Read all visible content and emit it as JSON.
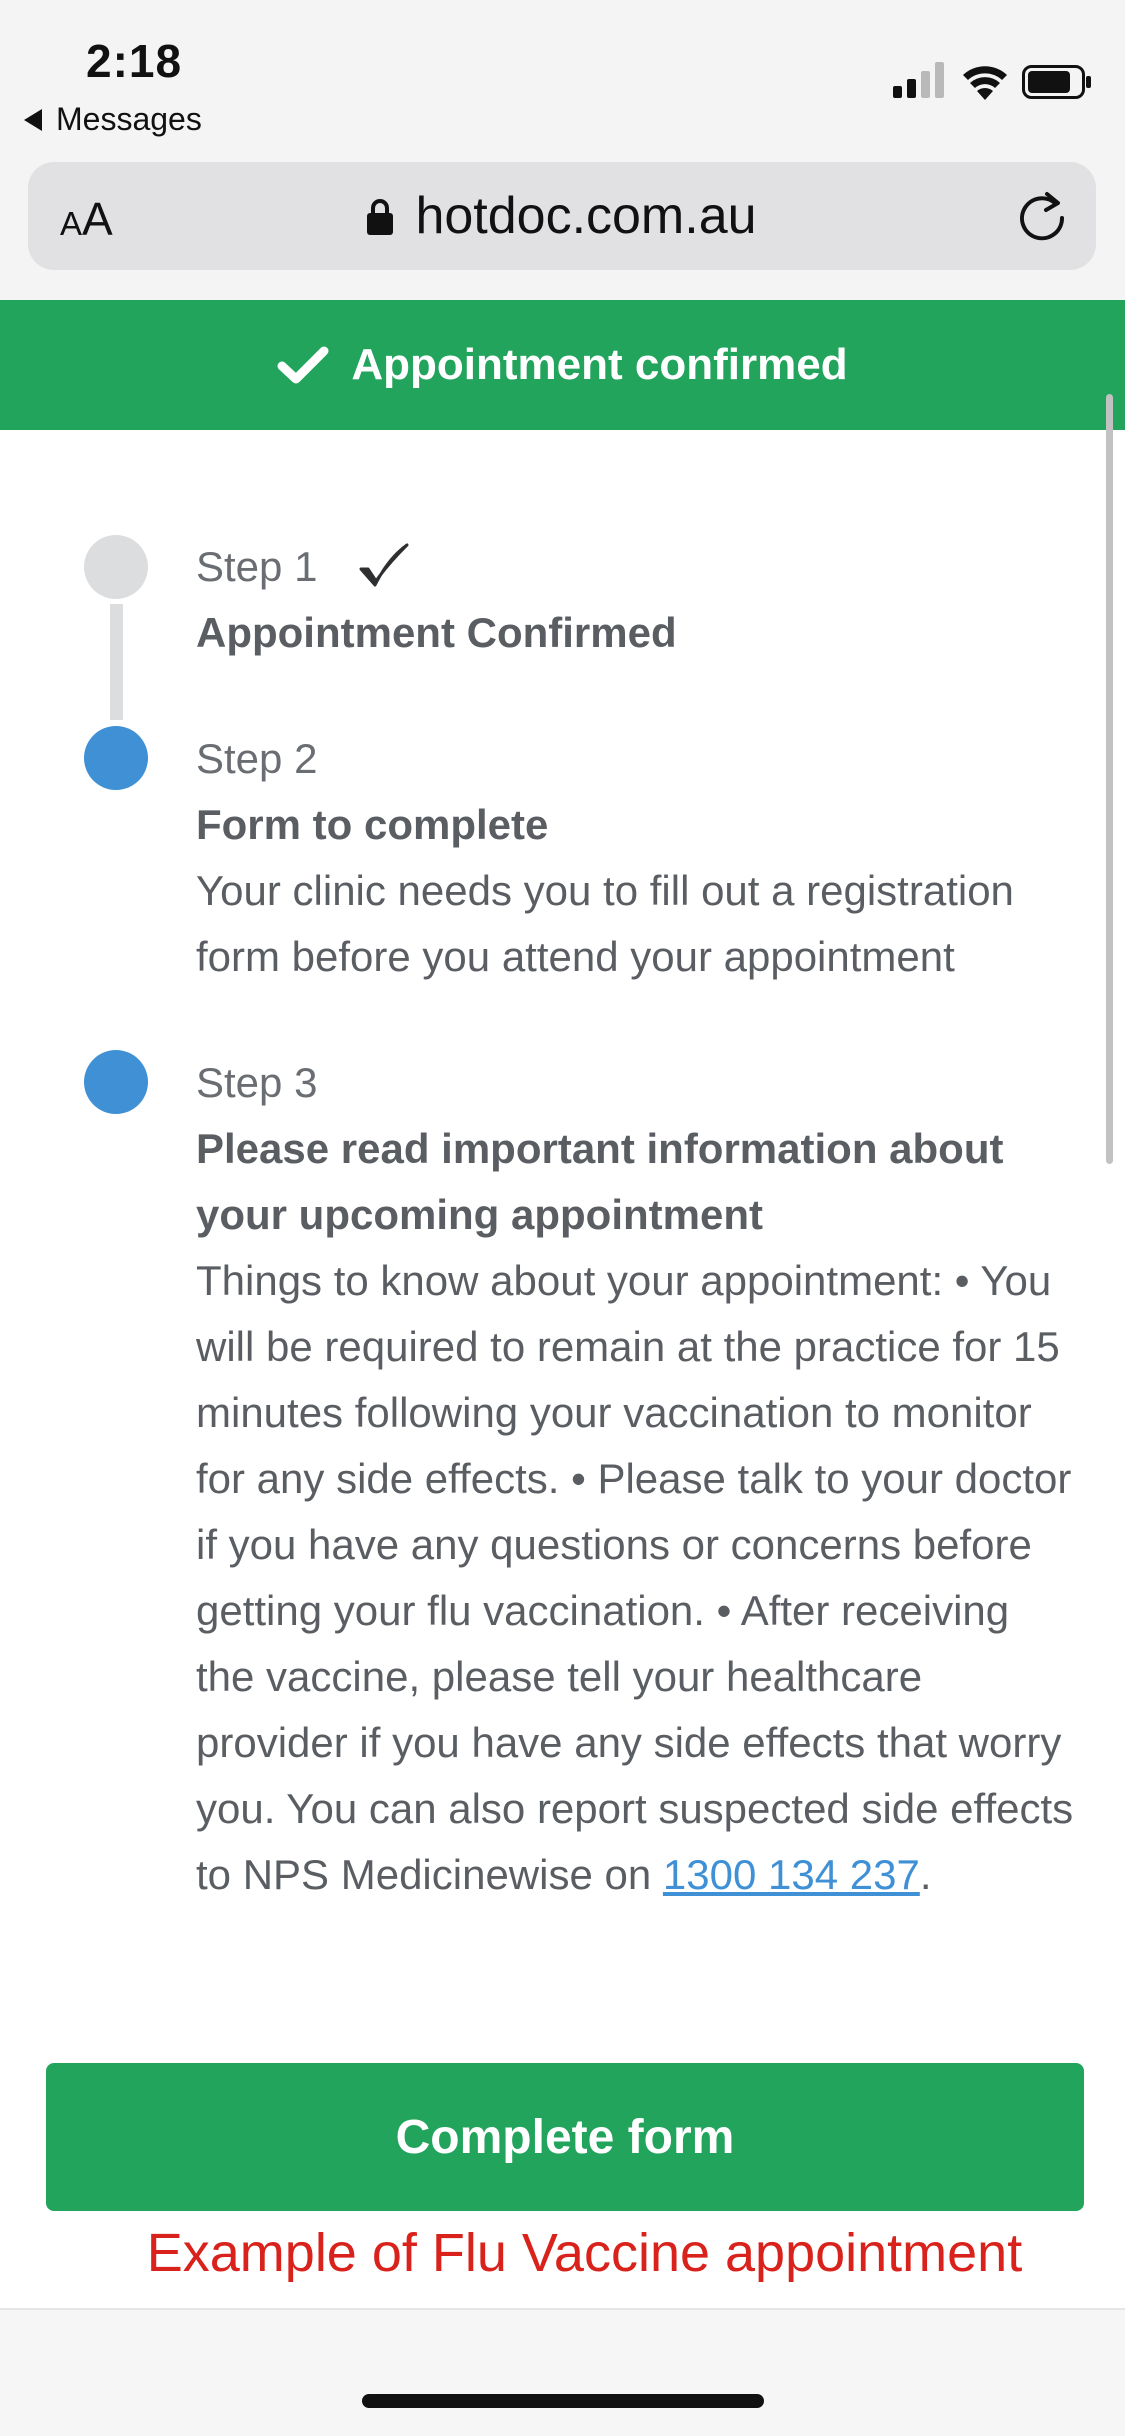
{
  "status_bar": {
    "time": "2:18",
    "back_label": "Messages"
  },
  "browser": {
    "text_size_button": "AA",
    "url": "hotdoc.com.au"
  },
  "banner": {
    "text": "Appointment confirmed",
    "color": "#22a45d"
  },
  "steps": [
    {
      "label": "Step 1",
      "title": "Appointment Confirmed",
      "status": "completed"
    },
    {
      "label": "Step 2",
      "title": "Form to complete",
      "text": "Your clinic needs you to fill out a registration form before you attend your appointment"
    },
    {
      "label": "Step 3",
      "title": "Please read important information about your upcoming appointment",
      "text": "Things to know about your appointment: • You will be required to remain at the practice for 15 minutes following your vaccination to monitor for any side effects. • Please talk to your doctor if you have any questions or concerns before getting your flu vaccination. • After receiving the vaccine, please tell your healthcare provider if you have any side effects that worry you. You can also report suspected side effects to NPS Medicinewise on ",
      "phone": "1300 134 237",
      "text_end": "."
    }
  ],
  "cta": {
    "label": "Complete form"
  },
  "caption": "Example of Flu Vaccine appointment",
  "colors": {
    "green": "#22a45d",
    "blue": "#3f90d5",
    "caption_red": "#d9221b"
  }
}
